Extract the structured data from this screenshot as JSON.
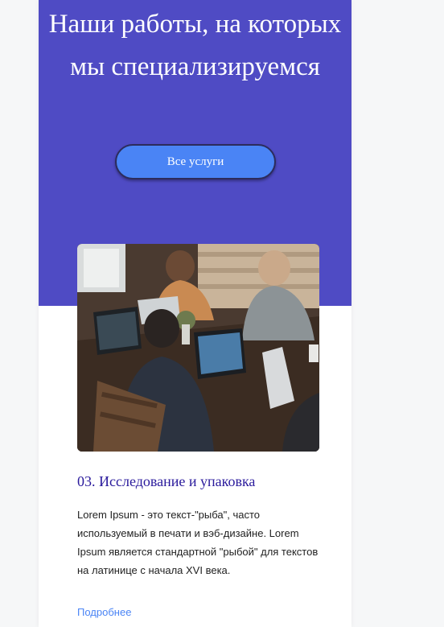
{
  "hero": {
    "title": "Наши работы, на которых мы специализируемся",
    "button_label": "Все услуги"
  },
  "item": {
    "title": "03. Исследование и упаковка",
    "description": "Lorem Ipsum - это текст-\"рыба\", часто используемый в печати и вэб-дизайне. Lorem Ipsum является стандартной \"рыбой\" для текстов на латинице с начала XVI века.",
    "more_label": "Подробнее"
  },
  "colors": {
    "hero_background": "#4f4bc4",
    "button_background": "#4a84f5",
    "title_color": "#2a1a9c",
    "link_color": "#4a84f5"
  }
}
